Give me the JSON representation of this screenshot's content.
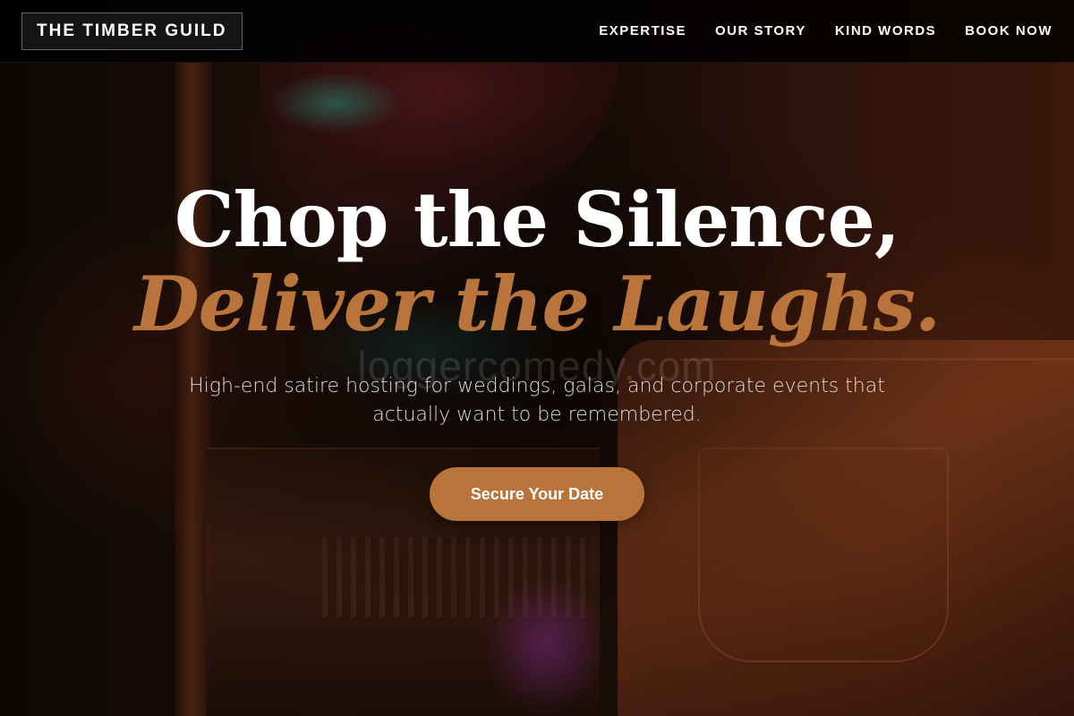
{
  "header": {
    "logo": "THE TIMBER GUILD",
    "nav": [
      {
        "label": "EXPERTISE"
      },
      {
        "label": "OUR STORY"
      },
      {
        "label": "KIND WORDS"
      },
      {
        "label": "BOOK NOW"
      }
    ]
  },
  "hero": {
    "title": "Chop the Silence,",
    "accent": "Deliver the Laughs.",
    "subtitle": "High-end satire hosting for weddings, galas, and corporate events that actually want to be remembered.",
    "cta": "Secure Your Date",
    "watermark": "loggercomedy.com"
  },
  "colors": {
    "accent": "#b8743a",
    "header_bg": "#000000",
    "text": "#ffffff"
  }
}
